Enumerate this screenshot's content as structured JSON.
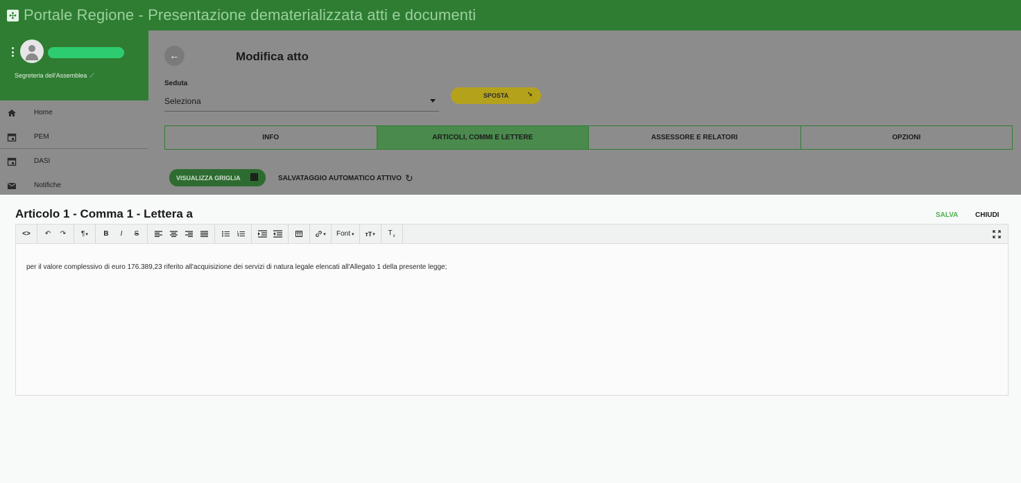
{
  "app": {
    "title": "Portale Regione - Presentazione dematerializzata atti e documenti",
    "brand_color": "#2e7d32"
  },
  "sidebar": {
    "role": "Segreteria dell'Assemblea",
    "items": [
      {
        "label": "Home",
        "icon": "home-icon"
      },
      {
        "label": "PEM",
        "icon": "calendar-icon"
      },
      {
        "label": "DASI",
        "icon": "calendar-icon"
      },
      {
        "label": "Notifiche",
        "icon": "mail-icon"
      }
    ]
  },
  "main": {
    "title": "Modifica atto",
    "seduta_label": "Seduta",
    "seduta_value": "Seleziona",
    "sposta_label": "SPOSTA",
    "tabs": [
      {
        "label": "INFO",
        "active": false
      },
      {
        "label": "ARTICOLI, COMMI E LETTERE",
        "active": true
      },
      {
        "label": "ASSESSORE E RELATORI",
        "active": false
      },
      {
        "label": "OPZIONI",
        "active": false
      }
    ],
    "grid_button_label": "VISUALIZZA GRIGLIA",
    "autosave_label": "SALVATAGGIO AUTOMATICO ATTIVO"
  },
  "editor": {
    "title": "Articolo 1 - Comma 1 - Lettera a",
    "save_label": "SALVA",
    "close_label": "CHIUDI",
    "font_label": "Font",
    "content": "per il valore complessivo di euro 176.389,23 riferito all'acquisizione dei servizi di natura legale elencati all'Allegato 1 della presente legge;",
    "save_color": "#4caf50"
  }
}
